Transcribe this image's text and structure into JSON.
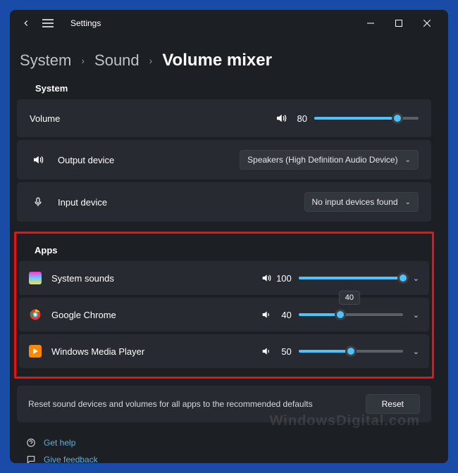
{
  "header": {
    "title": "Settings"
  },
  "breadcrumb": {
    "level1": "System",
    "level2": "Sound",
    "current": "Volume mixer"
  },
  "system_section": {
    "label": "System",
    "volume": {
      "label": "Volume",
      "value": "80",
      "percent": 80
    },
    "output": {
      "label": "Output device",
      "selected": "Speakers (High Definition Audio Device)"
    },
    "input": {
      "label": "Input device",
      "selected": "No input devices found"
    }
  },
  "apps_section": {
    "label": "Apps",
    "tooltip": "40",
    "items": [
      {
        "name": "System sounds",
        "value": "100",
        "percent": 100
      },
      {
        "name": "Google Chrome",
        "value": "40",
        "percent": 40
      },
      {
        "name": "Windows Media Player",
        "value": "50",
        "percent": 50
      }
    ]
  },
  "reset": {
    "text": "Reset sound devices and volumes for all apps to the recommended defaults",
    "button": "Reset"
  },
  "footer": {
    "help": "Get help",
    "feedback": "Give feedback"
  },
  "watermark": "WindowsDigital.com"
}
